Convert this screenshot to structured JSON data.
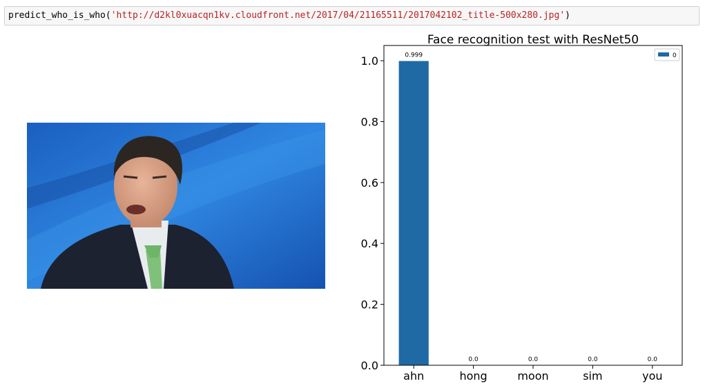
{
  "code_cell": {
    "function": "predict_who_is_who",
    "open": "(",
    "argument": "'http://d2kl0xuacqn1kv.cloudfront.net/2017/04/21165511/2017042102_title-500x280.jpg'",
    "close": ")"
  },
  "image": {
    "description_icon": "portrait-photo"
  },
  "chart_data": {
    "type": "bar",
    "title": "Face recognition test with ResNet50",
    "categories": [
      "ahn",
      "hong",
      "moon",
      "sim",
      "you"
    ],
    "series": [
      {
        "name": "0",
        "values": [
          0.999,
          0.0,
          0.0,
          0.0,
          0.0
        ],
        "color": "#1f6aa5"
      }
    ],
    "data_labels": [
      "0.999",
      "0.0",
      "0.0",
      "0.0",
      "0.0"
    ],
    "yticks": [
      "0.0",
      "0.2",
      "0.4",
      "0.6",
      "0.8",
      "1.0"
    ],
    "ylim": [
      0,
      1.05
    ],
    "xlabel": "",
    "ylabel": "",
    "grid": false,
    "legend_position": "top-right"
  }
}
